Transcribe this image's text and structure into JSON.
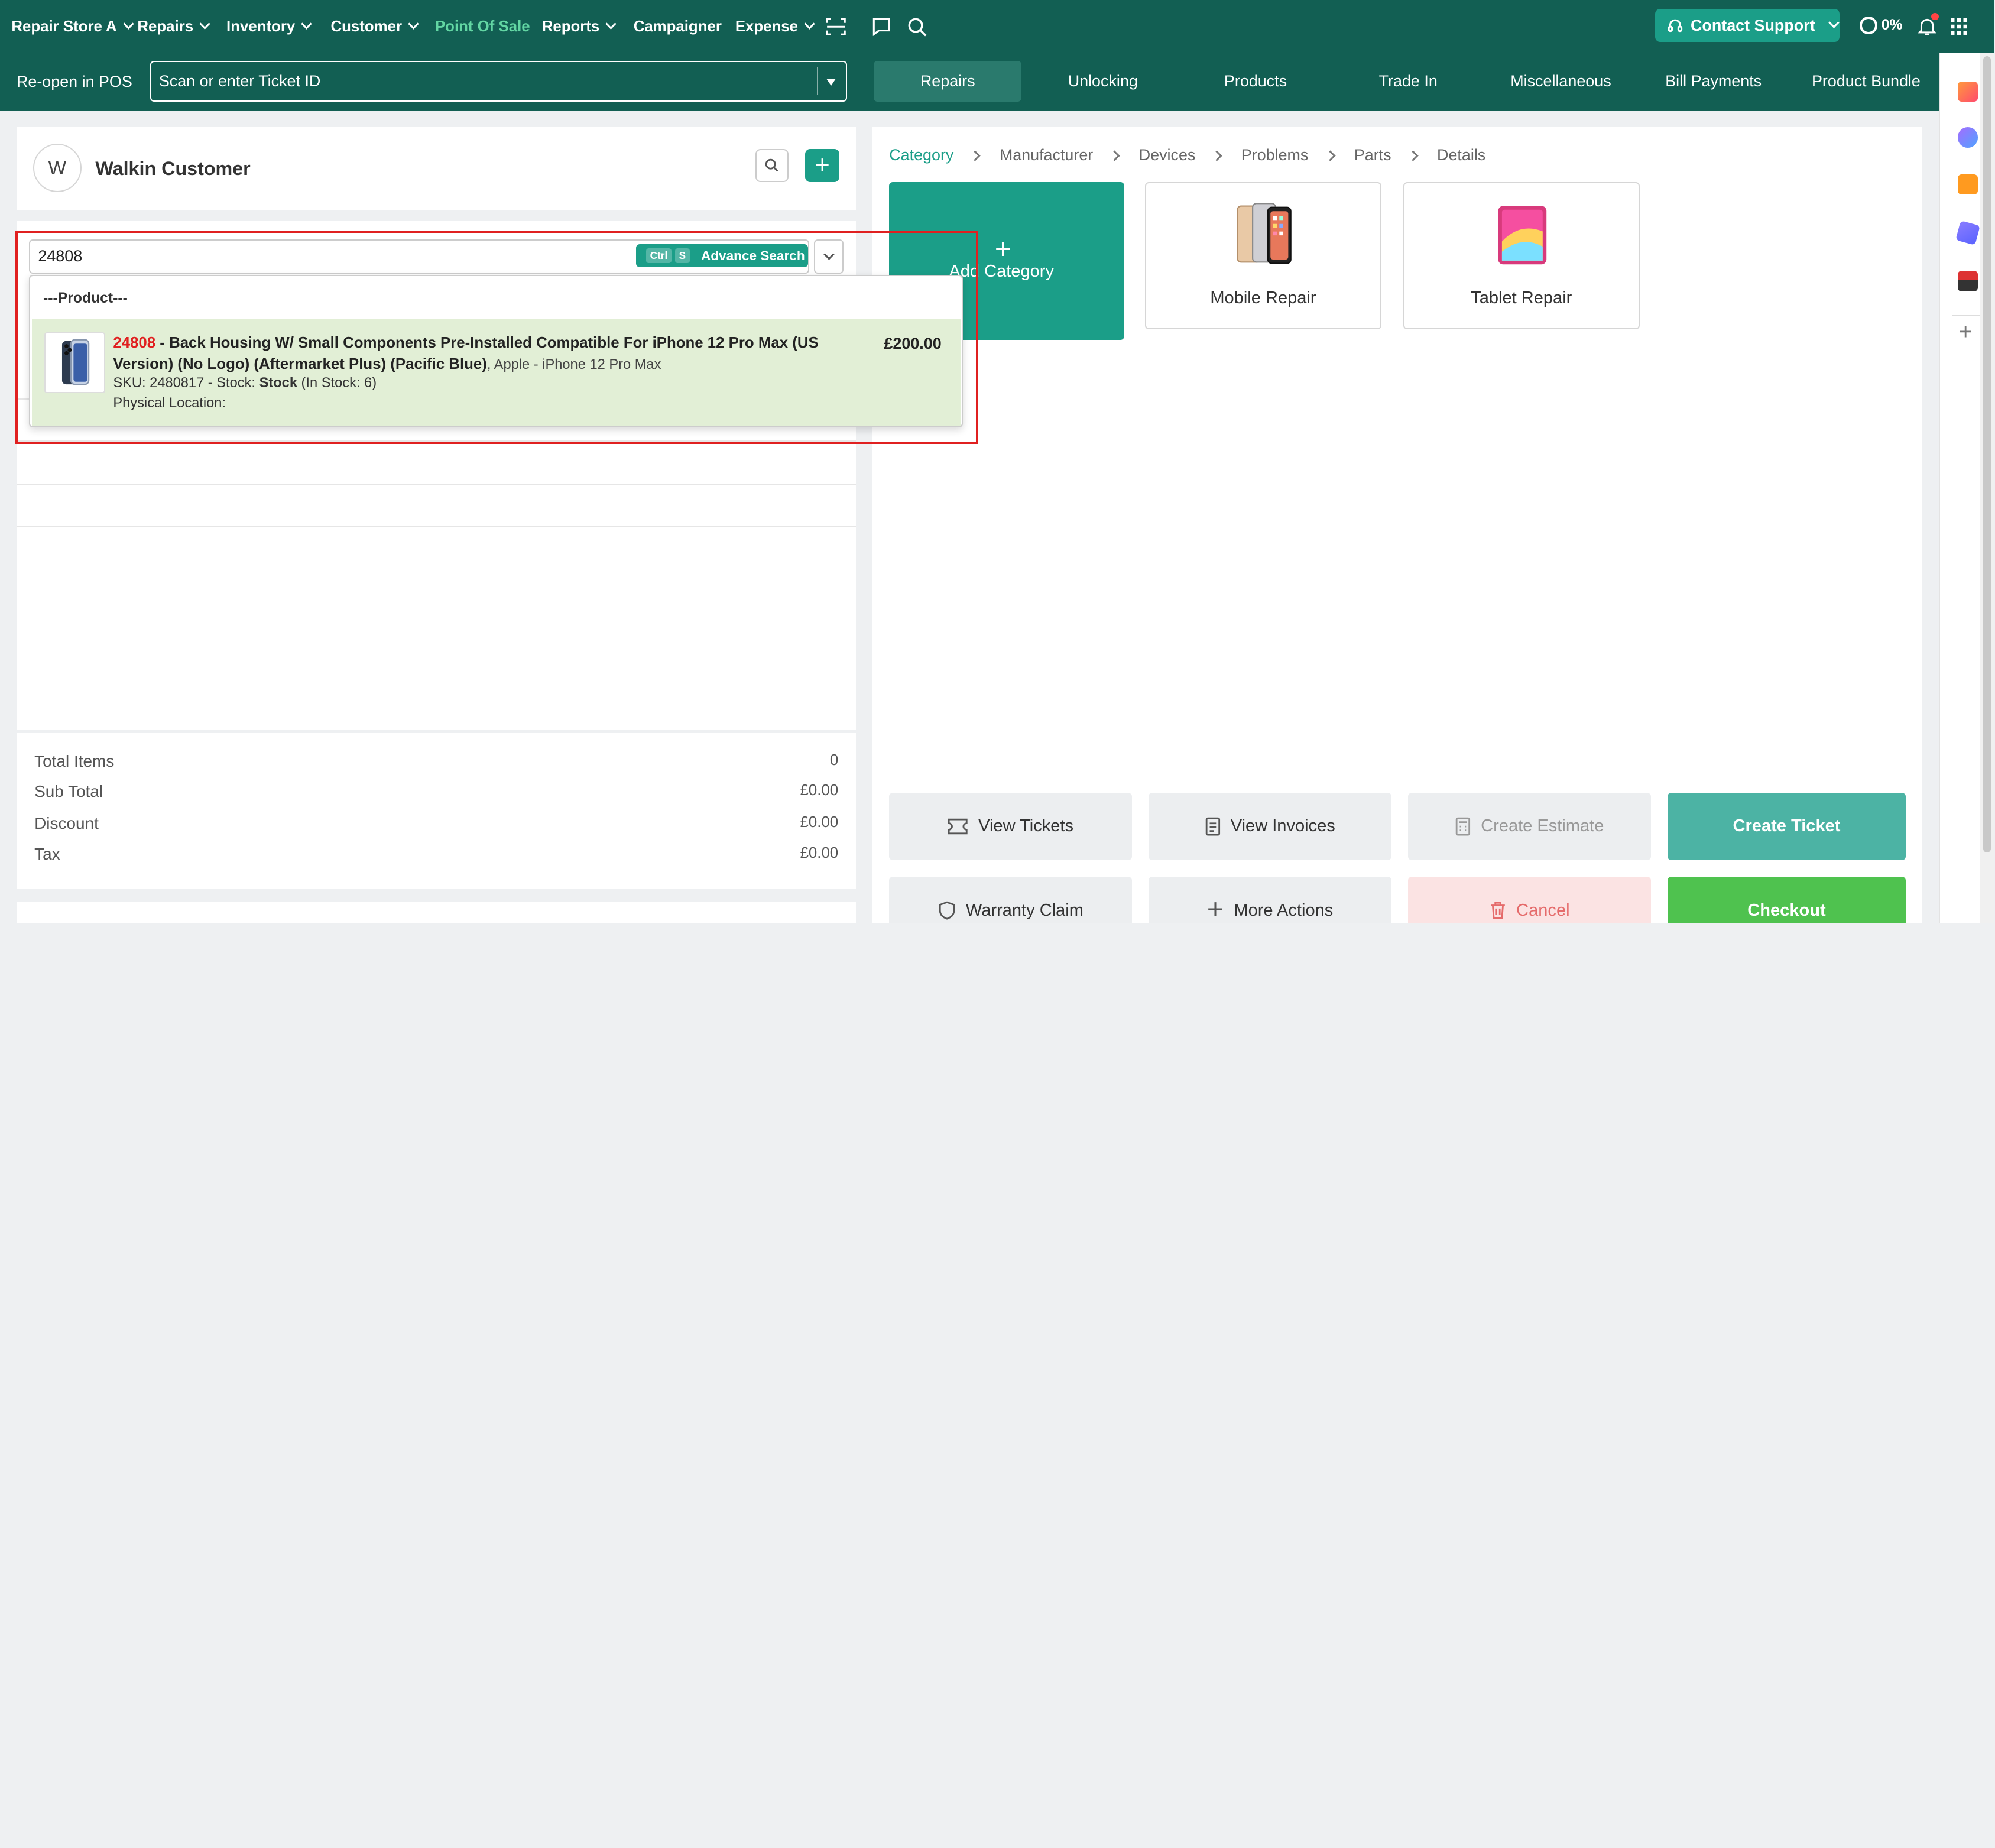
{
  "topnav": {
    "store": "Repair Store A",
    "items": [
      "Repairs",
      "Inventory",
      "Customer",
      "Point Of Sale",
      "Reports",
      "Campaigner",
      "Expense"
    ],
    "active": "Point Of Sale",
    "contact_support": "Contact Support",
    "progress": "0%"
  },
  "subbar": {
    "reopen_label": "Re-open in POS",
    "ticket_placeholder": "Scan or enter Ticket ID",
    "tabs": [
      "Repairs",
      "Unlocking",
      "Products",
      "Trade In",
      "Miscellaneous",
      "Bill Payments",
      "Product Bundle"
    ],
    "active_tab": "Repairs"
  },
  "customer": {
    "avatar": "W",
    "name": "Walkin Customer"
  },
  "product_search": {
    "value": "24808",
    "kbd1": "Ctrl",
    "kbd2": "S",
    "advance_label": "Advance Search",
    "group_label": "---Product---",
    "result": {
      "code": "24808",
      "title": " - Back Housing W/ Small Components Pre-Installed Compatible For iPhone 12 Pro Max (US Version) (No Logo) (Aftermarket Plus) (Pacific Blue)",
      "brand": ", Apple - iPhone 12 Pro Max",
      "sku_prefix": "SKU: 2480817 - Stock: ",
      "stock_label": "Stock",
      "stock_count": " (In Stock: 6)",
      "location": "Physical Location:",
      "price": "£200.00"
    }
  },
  "totals": {
    "items_label": "Total Items",
    "items_value": "0",
    "subtotal_label": "Sub Total",
    "subtotal_value": "£0.00",
    "discount_label": "Discount",
    "discount_value": "£0.00",
    "tax_label": "Tax",
    "tax_value": "£0.00"
  },
  "breadcrumb": [
    "Category",
    "Manufacturer",
    "Devices",
    "Problems",
    "Parts",
    "Details"
  ],
  "categories": {
    "add_label": "Add Category",
    "items": [
      "Mobile Repair",
      "Tablet Repair"
    ]
  },
  "actions": {
    "view_tickets": "View Tickets",
    "view_invoices": "View Invoices",
    "create_estimate": "Create Estimate",
    "create_ticket": "Create Ticket",
    "warranty_claim": "Warranty Claim",
    "more_actions": "More Actions",
    "cancel": "Cancel",
    "checkout": "Checkout"
  },
  "colors": {
    "header": "#125f53",
    "accent": "#1b9e88",
    "active_nav": "#62d6a3",
    "checkout": "#4fc24f",
    "highlight_code": "#e02020"
  }
}
